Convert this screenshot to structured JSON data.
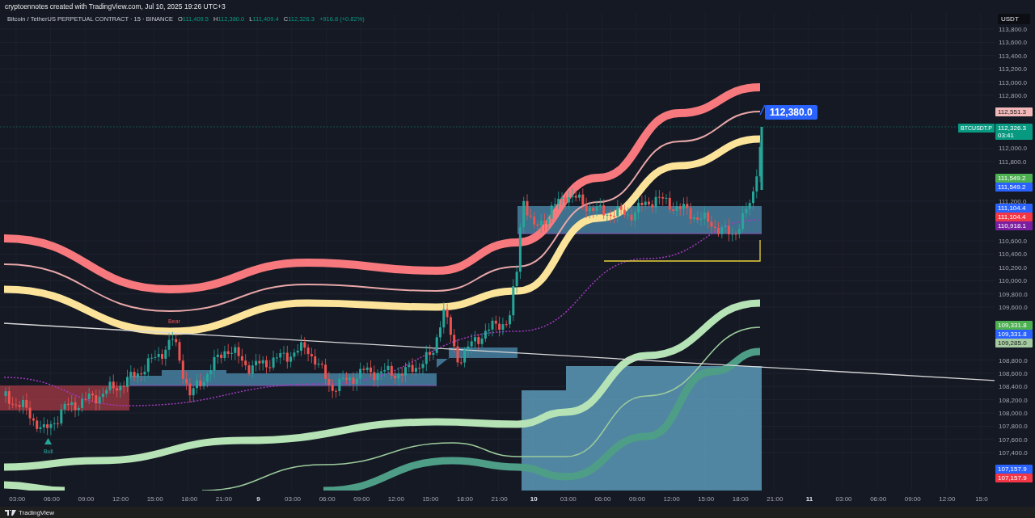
{
  "caption": "cryptoennotes created with TradingView.com, Jul 10, 2025 19:26 UTC+3",
  "legend": {
    "title": "Bitcoin / TetherUS PERPETUAL CONTRACT · 15 · BINANCE",
    "ohlc": [
      {
        "label": "O",
        "value": "111,409.5"
      },
      {
        "label": "H",
        "value": "112,380.0"
      },
      {
        "label": "L",
        "value": "111,409.4"
      },
      {
        "label": "C",
        "value": "112,326.3"
      }
    ],
    "change": "+916.8 (+0.82%)"
  },
  "chart": {
    "markers": [
      {
        "kind": "bear",
        "label": "Bear"
      },
      {
        "kind": "bull",
        "label": "Bull"
      }
    ],
    "callout": "112,380.0",
    "symbol_tag": "BTCUSDT.P"
  },
  "price_axis": {
    "currency": "USDT",
    "ticks": [
      "113,800.0",
      "113,600.0",
      "113,400.0",
      "113,200.0",
      "113,000.0",
      "112,800.0",
      "112,000.0",
      "111,800.0",
      "111,200.0",
      "110,600.0",
      "110,400.0",
      "110,200.0",
      "110,000.0",
      "109,800.0",
      "109,600.0",
      "108,800.0",
      "108,600.0",
      "108,400.0",
      "108,200.0",
      "108,000.0",
      "107,800.0",
      "107,600.0",
      "107,400.0"
    ],
    "tags": [
      {
        "value": "112,551.3",
        "color": "#f2b8b9"
      },
      {
        "value": "112,326.3",
        "sub": "03:41",
        "color": "#089981"
      },
      {
        "value": "111,549.2",
        "color": "#4caf50"
      },
      {
        "value": "111,549.2",
        "color": "#2962ff"
      },
      {
        "value": "111,104.4",
        "color": "#2962ff"
      },
      {
        "value": "111,104.4",
        "color": "#f23645"
      },
      {
        "value": "110,918.1",
        "color": "#7b1fa2"
      },
      {
        "value": "109,331.8",
        "color": "#4caf50"
      },
      {
        "value": "109,331.8",
        "color": "#2962ff"
      },
      {
        "value": "109,285.0",
        "color": "#a5c9a0"
      },
      {
        "value": "107,157.9",
        "color": "#2962ff"
      },
      {
        "value": "107,157.9",
        "color": "#f23645"
      }
    ]
  },
  "time_axis": {
    "labels": [
      {
        "text": "03:00",
        "kind": "time"
      },
      {
        "text": "06:00",
        "kind": "time"
      },
      {
        "text": "09:00",
        "kind": "time"
      },
      {
        "text": "12:00",
        "kind": "time"
      },
      {
        "text": "15:00",
        "kind": "time"
      },
      {
        "text": "18:00",
        "kind": "time"
      },
      {
        "text": "21:00",
        "kind": "time"
      },
      {
        "text": "9",
        "kind": "day"
      },
      {
        "text": "03:00",
        "kind": "time"
      },
      {
        "text": "06:00",
        "kind": "time"
      },
      {
        "text": "09:00",
        "kind": "time"
      },
      {
        "text": "12:00",
        "kind": "time"
      },
      {
        "text": "15:00",
        "kind": "time"
      },
      {
        "text": "18:00",
        "kind": "time"
      },
      {
        "text": "21:00",
        "kind": "time"
      },
      {
        "text": "10",
        "kind": "day"
      },
      {
        "text": "03:00",
        "kind": "time"
      },
      {
        "text": "06:00",
        "kind": "time"
      },
      {
        "text": "09:00",
        "kind": "time"
      },
      {
        "text": "12:00",
        "kind": "time"
      },
      {
        "text": "15:00",
        "kind": "time"
      },
      {
        "text": "18:00",
        "kind": "time"
      },
      {
        "text": "21:00",
        "kind": "time"
      },
      {
        "text": "11",
        "kind": "day"
      },
      {
        "text": "03:00",
        "kind": "time"
      },
      {
        "text": "06:00",
        "kind": "time"
      },
      {
        "text": "09:00",
        "kind": "time"
      },
      {
        "text": "12:00",
        "kind": "time"
      },
      {
        "text": "15:0",
        "kind": "time"
      }
    ]
  },
  "footer": {
    "brand": "TradingView"
  }
}
